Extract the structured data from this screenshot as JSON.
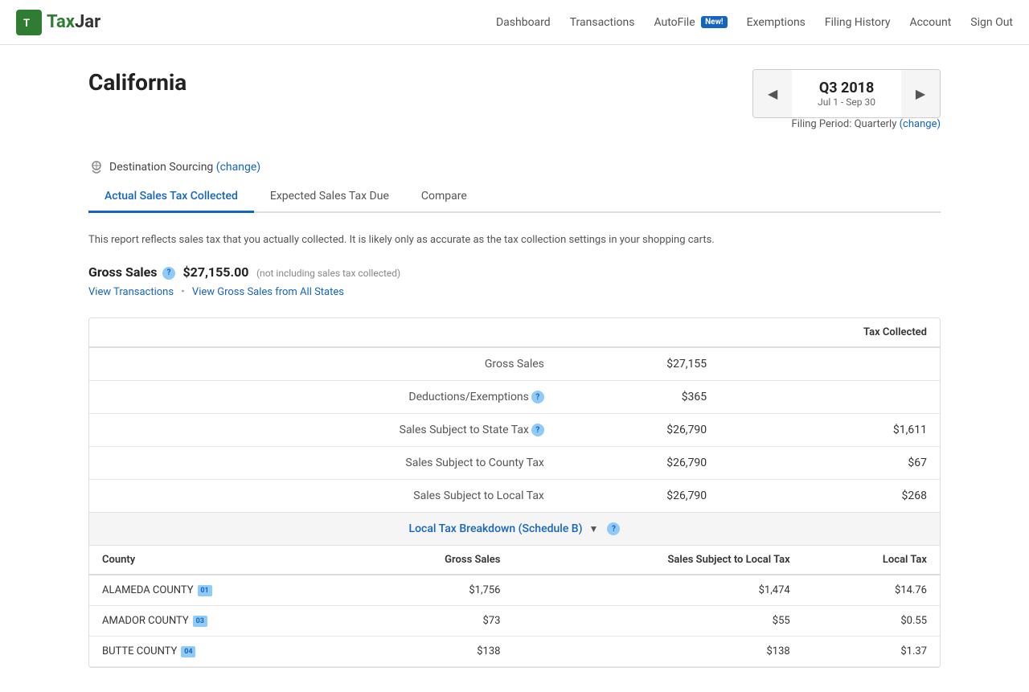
{
  "nav": {
    "logo_text": "TaxJar",
    "links": [
      {
        "label": "Dashboard",
        "name": "dashboard-link"
      },
      {
        "label": "Transactions",
        "name": "transactions-link"
      },
      {
        "label": "AutoFile",
        "name": "autofile-link",
        "badge": "New!"
      },
      {
        "label": "Exemptions",
        "name": "exemptions-link"
      },
      {
        "label": "Filing History",
        "name": "filing-history-link"
      },
      {
        "label": "Account",
        "name": "account-link"
      },
      {
        "label": "Sign Out",
        "name": "sign-out-link"
      }
    ]
  },
  "page": {
    "title": "California",
    "sourcing_text": "Destination Sourcing",
    "sourcing_change": "(change)",
    "period_quarter": "Q3 2018",
    "period_dates": "Jul 1 - Sep 30",
    "filing_period_label": "Filing Period: Quarterly",
    "filing_period_change": "(change)"
  },
  "tabs": [
    {
      "label": "Actual Sales Tax Collected",
      "active": true
    },
    {
      "label": "Expected Sales Tax Due",
      "active": false
    },
    {
      "label": "Compare",
      "active": false
    }
  ],
  "report": {
    "info_text": "This report reflects sales tax that you actually collected. It is likely only as accurate as the tax collection settings in your shopping carts.",
    "gross_sales_label": "Gross Sales",
    "gross_sales_value": "$27,155.00",
    "gross_sales_note": "(not including sales tax collected)",
    "view_transactions": "View Transactions",
    "view_gross_sales": "View Gross Sales from All States"
  },
  "table": {
    "header_col1": "",
    "header_tax_collected": "Tax Collected",
    "rows": [
      {
        "label": "Gross Sales",
        "amount": "$27,155",
        "tax": ""
      },
      {
        "label": "Deductions/Exemptions",
        "amount": "$365",
        "tax": "",
        "info": true
      },
      {
        "label": "Sales Subject to State Tax",
        "amount": "$26,790",
        "tax": "$1,611",
        "info": true
      },
      {
        "label": "Sales Subject to County Tax",
        "amount": "$26,790",
        "tax": "$67"
      },
      {
        "label": "Sales Subject to Local Tax",
        "amount": "$26,790",
        "tax": "$268"
      }
    ]
  },
  "breakdown": {
    "label": "Local Tax Breakdown (Schedule B)",
    "info_icon": true
  },
  "county_table": {
    "headers": [
      "County",
      "Gross Sales",
      "Sales Subject to Local Tax",
      "Local Tax"
    ],
    "rows": [
      {
        "county": "ALAMEDA COUNTY",
        "badge": "01",
        "gross_sales": "$1,756",
        "subject": "$1,474",
        "local_tax": "$14.76"
      },
      {
        "county": "AMADOR COUNTY",
        "badge": "03",
        "gross_sales": "$73",
        "subject": "$55",
        "local_tax": "$0.55"
      },
      {
        "county": "BUTTE COUNTY",
        "badge": "04",
        "gross_sales": "$138",
        "subject": "$138",
        "local_tax": "$1.37"
      }
    ]
  }
}
